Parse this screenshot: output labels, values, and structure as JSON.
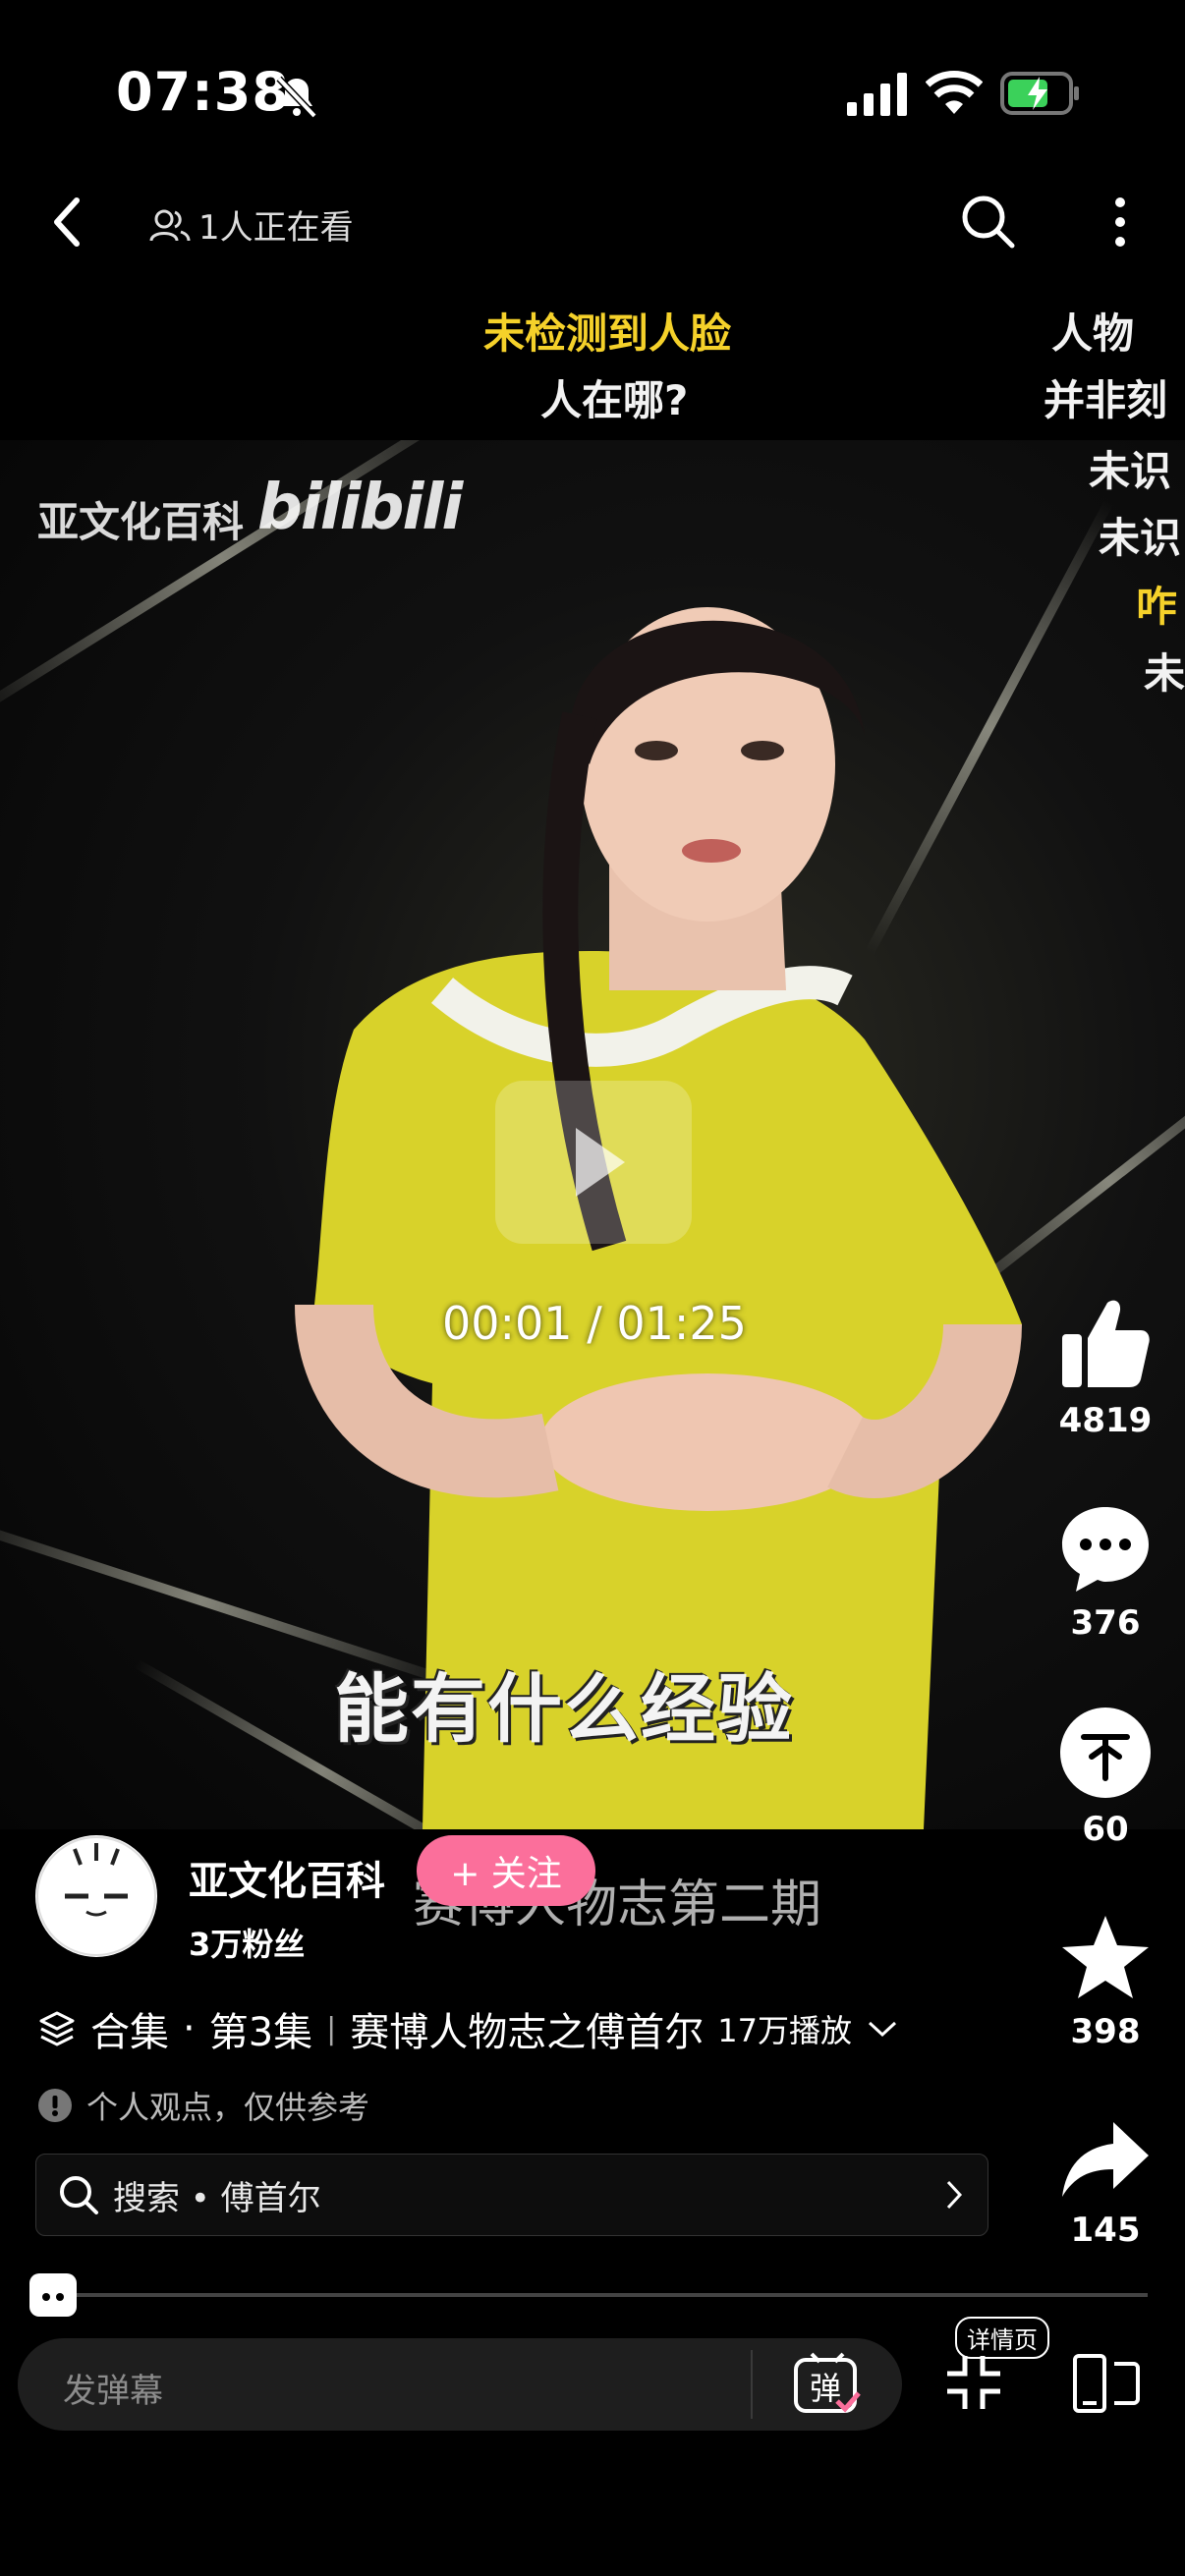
{
  "status_bar": {
    "time": "07:38"
  },
  "top_bar": {
    "viewers": "1人正在看"
  },
  "danmaku": [
    {
      "text": "未检测到人脸",
      "color": "yellow"
    },
    {
      "text": "人在哪?",
      "color": "white"
    },
    {
      "text": "人物",
      "color": "white"
    },
    {
      "text": "并非刻",
      "color": "white"
    },
    {
      "text": "未识",
      "color": "white"
    },
    {
      "text": "未识",
      "color": "white"
    },
    {
      "text": "咋",
      "color": "yellow"
    },
    {
      "text": "未",
      "color": "white"
    }
  ],
  "video": {
    "watermark_text": "亚文化百科",
    "watermark_logo": "bilibili",
    "current_time": "00:01",
    "separator": "/",
    "duration": "01:25",
    "subtitle": "能有什么经验"
  },
  "actions": {
    "like_count": "4819",
    "comment_count": "376",
    "coin_count": "60",
    "favorite_count": "398",
    "share_count": "145"
  },
  "channel": {
    "name": "亚文化百科",
    "fans": "3万粉丝",
    "follow_label": "+ 关注",
    "overlap_text": "赛博人物志第二期"
  },
  "collection": {
    "label": "合集",
    "dot": "·",
    "episode": "第3集",
    "divider": "|",
    "title": "赛博人物志之傅首尔",
    "plays": "17万播放"
  },
  "notice": "个人观点，仅供参考",
  "search": {
    "text": "搜索 • 傅首尔"
  },
  "bottom": {
    "danmaku_placeholder": "发弹幕",
    "danmaku_toggle": "弹",
    "detail_label": "详情页"
  },
  "colors": {
    "follow": "#fb6f9b",
    "danmaku_yellow": "#f5d12a"
  }
}
